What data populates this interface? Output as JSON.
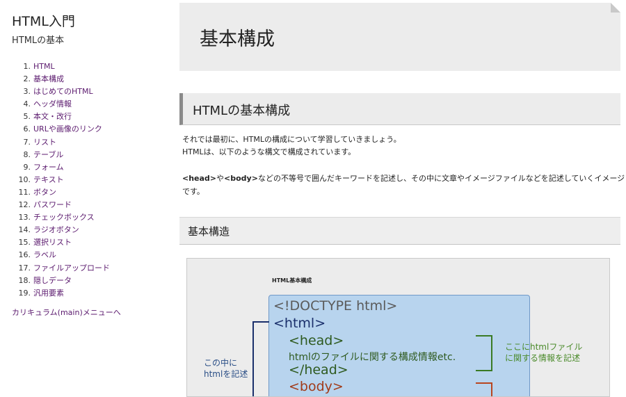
{
  "sidebar": {
    "title": "HTML入門",
    "subtitle": "HTMLの基本",
    "items": [
      {
        "num": "1.",
        "label": "HTML"
      },
      {
        "num": "2.",
        "label": "基本構成"
      },
      {
        "num": "3.",
        "label": "はじめてのHTML"
      },
      {
        "num": "4.",
        "label": "ヘッダ情報"
      },
      {
        "num": "5.",
        "label": "本文・改行"
      },
      {
        "num": "6.",
        "label": "URLや画像のリンク"
      },
      {
        "num": "7.",
        "label": "リスト"
      },
      {
        "num": "8.",
        "label": "テーブル"
      },
      {
        "num": "9.",
        "label": "フォーム"
      },
      {
        "num": "10.",
        "label": "テキスト"
      },
      {
        "num": "11.",
        "label": "ボタン"
      },
      {
        "num": "12.",
        "label": "パスワード"
      },
      {
        "num": "13.",
        "label": "チェックボックス"
      },
      {
        "num": "14.",
        "label": "ラジオボタン"
      },
      {
        "num": "15.",
        "label": "選択リスト"
      },
      {
        "num": "16.",
        "label": "ラベル"
      },
      {
        "num": "17.",
        "label": "ファイルアップロード"
      },
      {
        "num": "18.",
        "label": "隠しデータ"
      },
      {
        "num": "19.",
        "label": "汎用要素"
      }
    ],
    "menu_link": "カリキュラム(main)メニューへ"
  },
  "main": {
    "page_title": "基本構成",
    "section_title": "HTMLの基本構成",
    "para1_line1": "それでは最初に、HTMLの構成について学習していきましょう。",
    "para1_line2": "HTMLは、以下のような構文で構成されています。",
    "para2_head": "<head>",
    "para2_ya": "や",
    "para2_body": "<body>",
    "para2_rest": "などの不等号で囲んだキーワードを記述し、その中に文章やイメージファイルなどを記述していくイメージ",
    "para2_line2": "です。",
    "subsection_title": "基本構造"
  },
  "figure": {
    "title": "HTML基本構成",
    "code_doctype": "<!DOCTYPE html>",
    "code_html": "<html>",
    "code_head": "<head>",
    "code_head_info": "htmlのファイルに関する構成情報etc.",
    "code_head_close": "</head>",
    "code_body": "<body>",
    "note_left_1": "この中に",
    "note_left_2": "htmlを記述",
    "note_right_1": "ここにhtmlファイル",
    "note_right_2": "に関する情報を記述",
    "colors": {
      "code_box": "#b8d4ee",
      "html_blue": "#1a2f6b",
      "head_green": "#2e5a1f",
      "body_red": "#a13b1a"
    }
  },
  "colors": {
    "link": "#5b1a6e",
    "header_bg": "#ececec"
  }
}
